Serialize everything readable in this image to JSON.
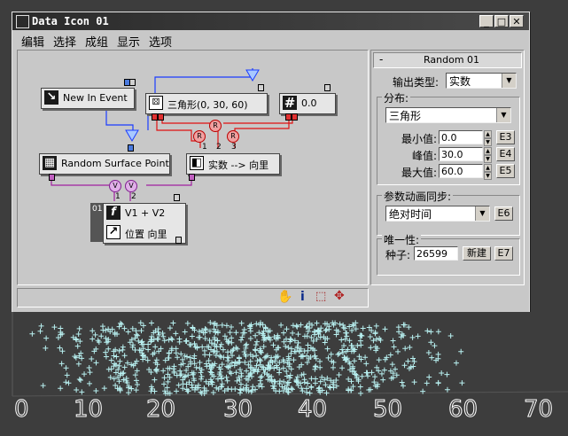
{
  "window": {
    "title": "Data Icon 01",
    "min": "_",
    "max": "□",
    "close": "✕"
  },
  "menu": [
    "编辑",
    "选择",
    "成组",
    "显示",
    "选项"
  ],
  "nodes": {
    "new_in_event": "New In Event",
    "shape": "三角形(0, 30, 60)",
    "float": "0.0",
    "random_surface": "Random Surface Point",
    "real_to_vec": "实数 --> 向里",
    "expr_line1": "V1 + V2",
    "expr_line2": "位置 向里",
    "expr_id": "01",
    "float_glyph": "#",
    "expr_glyph": "f"
  },
  "ports": {
    "r": "R",
    "v": "V",
    "n1": "1",
    "n2": "2",
    "n3": "3"
  },
  "panel": {
    "rollout_title": "Random 01",
    "rollout_toggle": "-",
    "output_type_label": "输出类型:",
    "output_type": "实数",
    "dist_label": "分布:",
    "dist_value": "三角形",
    "min_label": "最小值:",
    "min_value": "0.0",
    "peak_label": "峰值:",
    "peak_value": "30.0",
    "max_label": "最大值:",
    "max_value": "60.0",
    "e3": "E3",
    "e4": "E4",
    "e5": "E5",
    "anim_label": "参数动画同步:",
    "anim_value": "绝对时间",
    "e6": "E6",
    "unique_label": "唯一性:",
    "seed_label": "种子:",
    "seed_value": "26599",
    "new_label": "新建",
    "e7": "E7"
  },
  "viewport": {
    "axis_labels": [
      "0",
      "10",
      "20",
      "30",
      "40",
      "50",
      "60",
      "70"
    ],
    "particle_color": "#b8f0f0"
  }
}
